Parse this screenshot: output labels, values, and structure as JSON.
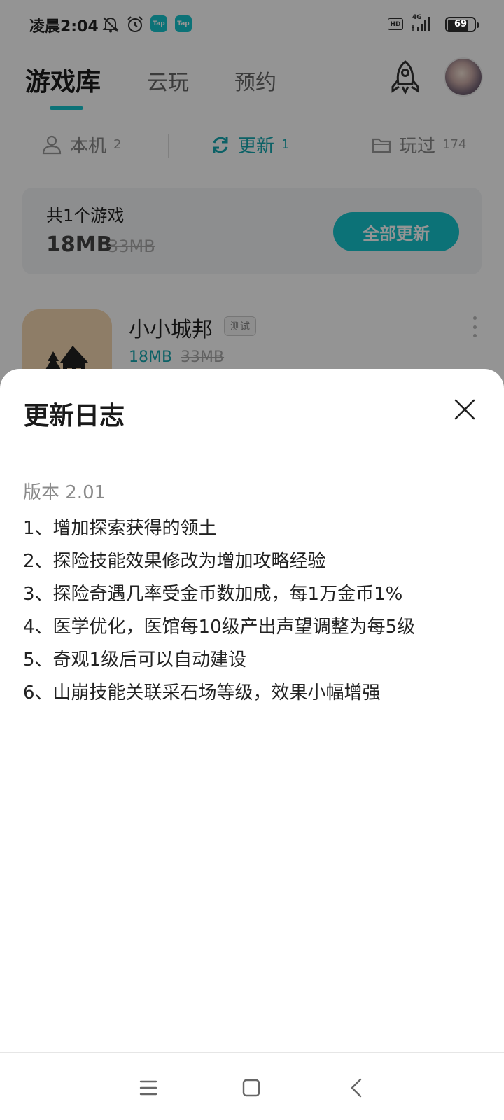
{
  "status_bar": {
    "time": "凌晨2:04",
    "tap_badge": "Tap",
    "hd": "HD",
    "network": "4G",
    "battery": "69",
    "icons": [
      "mute-bell-icon",
      "alarm-icon",
      "tap-app-icon",
      "tap-app-icon",
      "hd-icon",
      "signal-icon",
      "battery-icon"
    ]
  },
  "header": {
    "tabs": [
      {
        "label": "游戏库"
      },
      {
        "label": "云玩"
      },
      {
        "label": "预约"
      }
    ],
    "accent_color": "#15c5ce",
    "icons": [
      "rocket-icon",
      "avatar"
    ]
  },
  "subtabs": [
    {
      "label": "本机",
      "count": "2",
      "icon": "user-device-icon"
    },
    {
      "label": "更新",
      "count": "1",
      "icon": "refresh-icon"
    },
    {
      "label": "玩过",
      "count": "174",
      "icon": "folder-icon"
    }
  ],
  "summary": {
    "title": "共1个游戏",
    "size": "18MB",
    "old_size": "33MB",
    "button": "全部更新"
  },
  "game": {
    "name": "小小城邦",
    "tag": "测试",
    "size": "18MB",
    "old_size": "33MB"
  },
  "sheet": {
    "title": "更新日志",
    "version": "版本 2.01",
    "items": [
      "1、增加探索获得的领土",
      "2、探险技能效果修改为增加攻略经验",
      "3、探险奇遇几率受金币数加成，每1万金币1%",
      "4、医学优化，医馆每10级产出声望调整为每5级",
      "5、奇观1级后可以自动建设",
      "6、山崩技能关联采石场等级，效果小幅增强"
    ]
  },
  "navbar": {
    "icons": [
      "menu-icon",
      "home-icon",
      "back-icon"
    ]
  }
}
